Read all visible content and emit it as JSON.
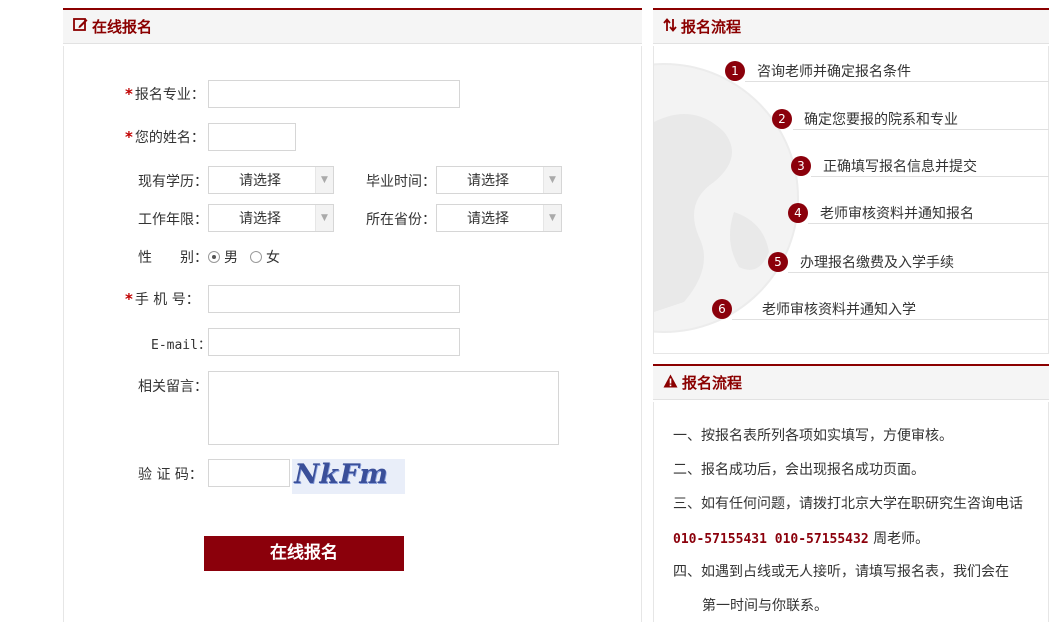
{
  "form": {
    "title": "在线报名",
    "required_mark": "*",
    "major_label": "报名专业：",
    "name_label": "您的姓名：",
    "education_label": "现有学历：",
    "education_value": "请选择",
    "graduation_label": "毕业时间：",
    "graduation_value": "请选择",
    "years_label": "工作年限：",
    "years_value": "请选择",
    "province_label": "所在省份：",
    "province_value": "请选择",
    "gender_label": "性　　别：",
    "gender_male": "男",
    "gender_female": "女",
    "phone_label": "手 机 号：",
    "email_label": "E-mail：",
    "message_label": "相关留言：",
    "captcha_label": "验 证 码：",
    "captcha_text": "NkFm",
    "submit_label": "在线报名"
  },
  "flow": {
    "title": "报名流程",
    "steps": [
      {
        "num": "1",
        "text": "咨询老师并确定报名条件"
      },
      {
        "num": "2",
        "text": "确定您要报的院系和专业"
      },
      {
        "num": "3",
        "text": "正确填写报名信息并提交"
      },
      {
        "num": "4",
        "text": "老师审核资料并通知报名"
      },
      {
        "num": "5",
        "text": "办理报名缴费及入学手续"
      },
      {
        "num": "6",
        "text": "老师审核资料并通知入学"
      }
    ]
  },
  "notes": {
    "title": "报名流程",
    "line1": "一、按报名表所列各项如实填写，方便审核。",
    "line2": "二、报名成功后，会出现报名成功页面。",
    "line3": "三、如有任何问题，请拨打北京大学在职研究生咨询电话",
    "phone": "010-57155431 010-57155432",
    "teacher": " 周老师。",
    "line4": "四、如遇到占线或无人接听，请填写报名表，我们会在",
    "line5": "第一时间与你联系。"
  },
  "colors": {
    "accent": "#8b000b",
    "border": "#d6d6d6"
  }
}
